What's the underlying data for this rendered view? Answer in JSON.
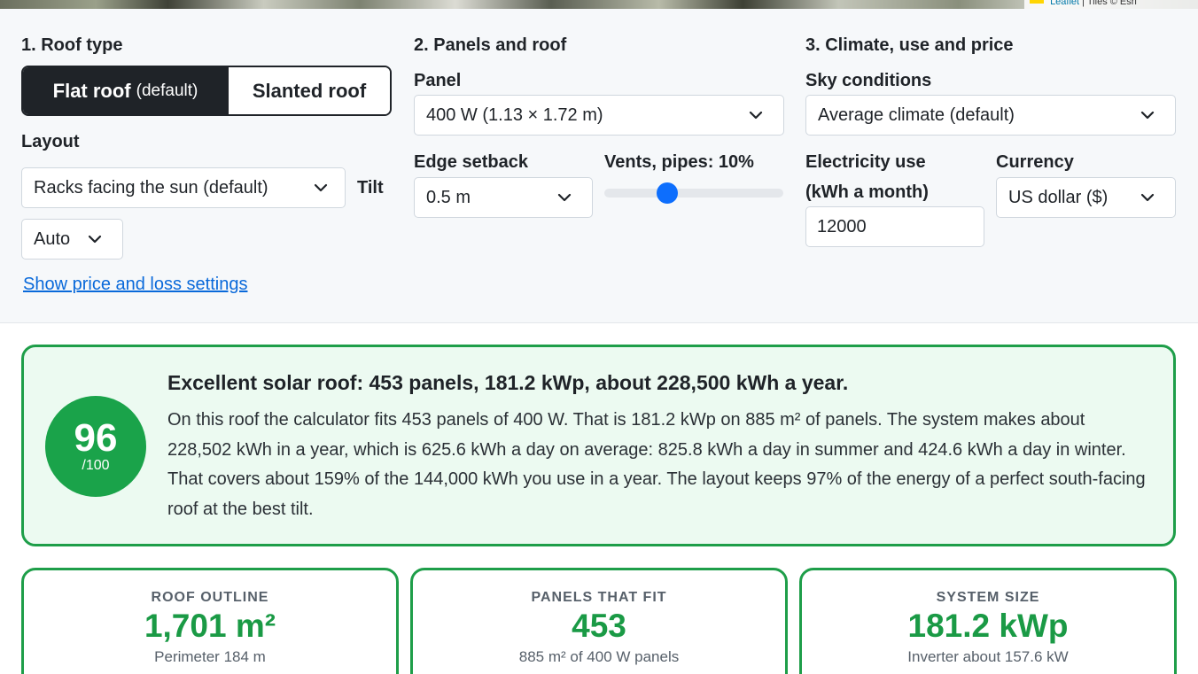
{
  "map": {
    "attribution_link": "Leaflet",
    "attribution_rest": "| Tiles © Esri"
  },
  "roof": {
    "title": "1. Roof type",
    "flat_label": "Flat roof",
    "flat_default": "(default)",
    "slanted_label": "Slanted roof",
    "layout_label": "Layout",
    "layout_value": "Racks facing the sun (default)",
    "tilt_label": "Tilt",
    "tilt_value": "Auto",
    "settings_link": "Show price and loss settings"
  },
  "panels": {
    "title": "2. Panels and roof",
    "panel_label": "Panel",
    "panel_value": "400 W (1.13 × 1.72 m)",
    "setback_label": "Edge setback",
    "setback_value": "0.5 m",
    "vents_label": "Vents, pipes: 10%",
    "vents_value": 10
  },
  "climate": {
    "title": "3. Climate, use and price",
    "sky_label": "Sky conditions",
    "sky_value": "Average climate (default)",
    "use_label_1": "Electricity use",
    "use_label_2": "(kWh a month)",
    "use_value": "12000",
    "currency_label": "Currency",
    "currency_value": "US dollar ($)"
  },
  "summary": {
    "score": "96",
    "score_max": "/100",
    "headline": "Excellent solar roof: 453 panels, 181.2 kWp, about 228,500 kWh a year.",
    "body": "On this roof the calculator fits 453 panels of 400 W. That is 181.2 kWp on 885 m² of panels. The system makes about 228,502 kWh in a year, which is 625.6 kWh a day on average: 825.8 kWh a day in summer and 424.6 kWh a day in winter. That covers about 159% of the 144,000 kWh you use in a year. The layout keeps 97% of the energy of a perfect south-facing roof at the best tilt."
  },
  "cards": [
    {
      "caption": "ROOF OUTLINE",
      "value": "1,701 m²",
      "sub": "Perimeter 184 m"
    },
    {
      "caption": "PANELS THAT FIT",
      "value": "453",
      "sub": "885 m² of 400 W panels"
    },
    {
      "caption": "SYSTEM SIZE",
      "value": "181.2 kWp",
      "sub": "Inverter about 157.6 kW"
    }
  ],
  "colors": {
    "accent_green": "#1aa34a",
    "slider_blue": "#0d6efd",
    "link_blue": "#0969da",
    "dark": "#1f2328"
  },
  "icons": {
    "dropdown": "chevron-down-icon"
  }
}
